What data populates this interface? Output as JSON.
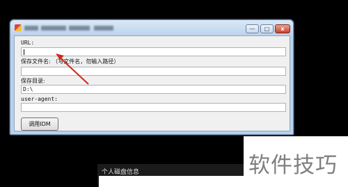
{
  "window": {
    "title": "",
    "controls": {
      "minimize": "—",
      "maximize": "□",
      "close": "x"
    }
  },
  "form": {
    "url_label": "URL:",
    "url_value": "",
    "filename_label": "保存文件名: （写文件名，勿输入路径）",
    "filename_value": "",
    "dir_label": "保存目录:",
    "dir_value": "D:\\",
    "useragent_label": "user-agent:",
    "useragent_value": "",
    "submit_label": "调用IDM"
  },
  "bottom_window": {
    "title": "个人磁盘信息"
  },
  "watermark": "软件技巧",
  "colors": {
    "annotation_arrow": "#d0281b",
    "desktop": "#000000"
  }
}
